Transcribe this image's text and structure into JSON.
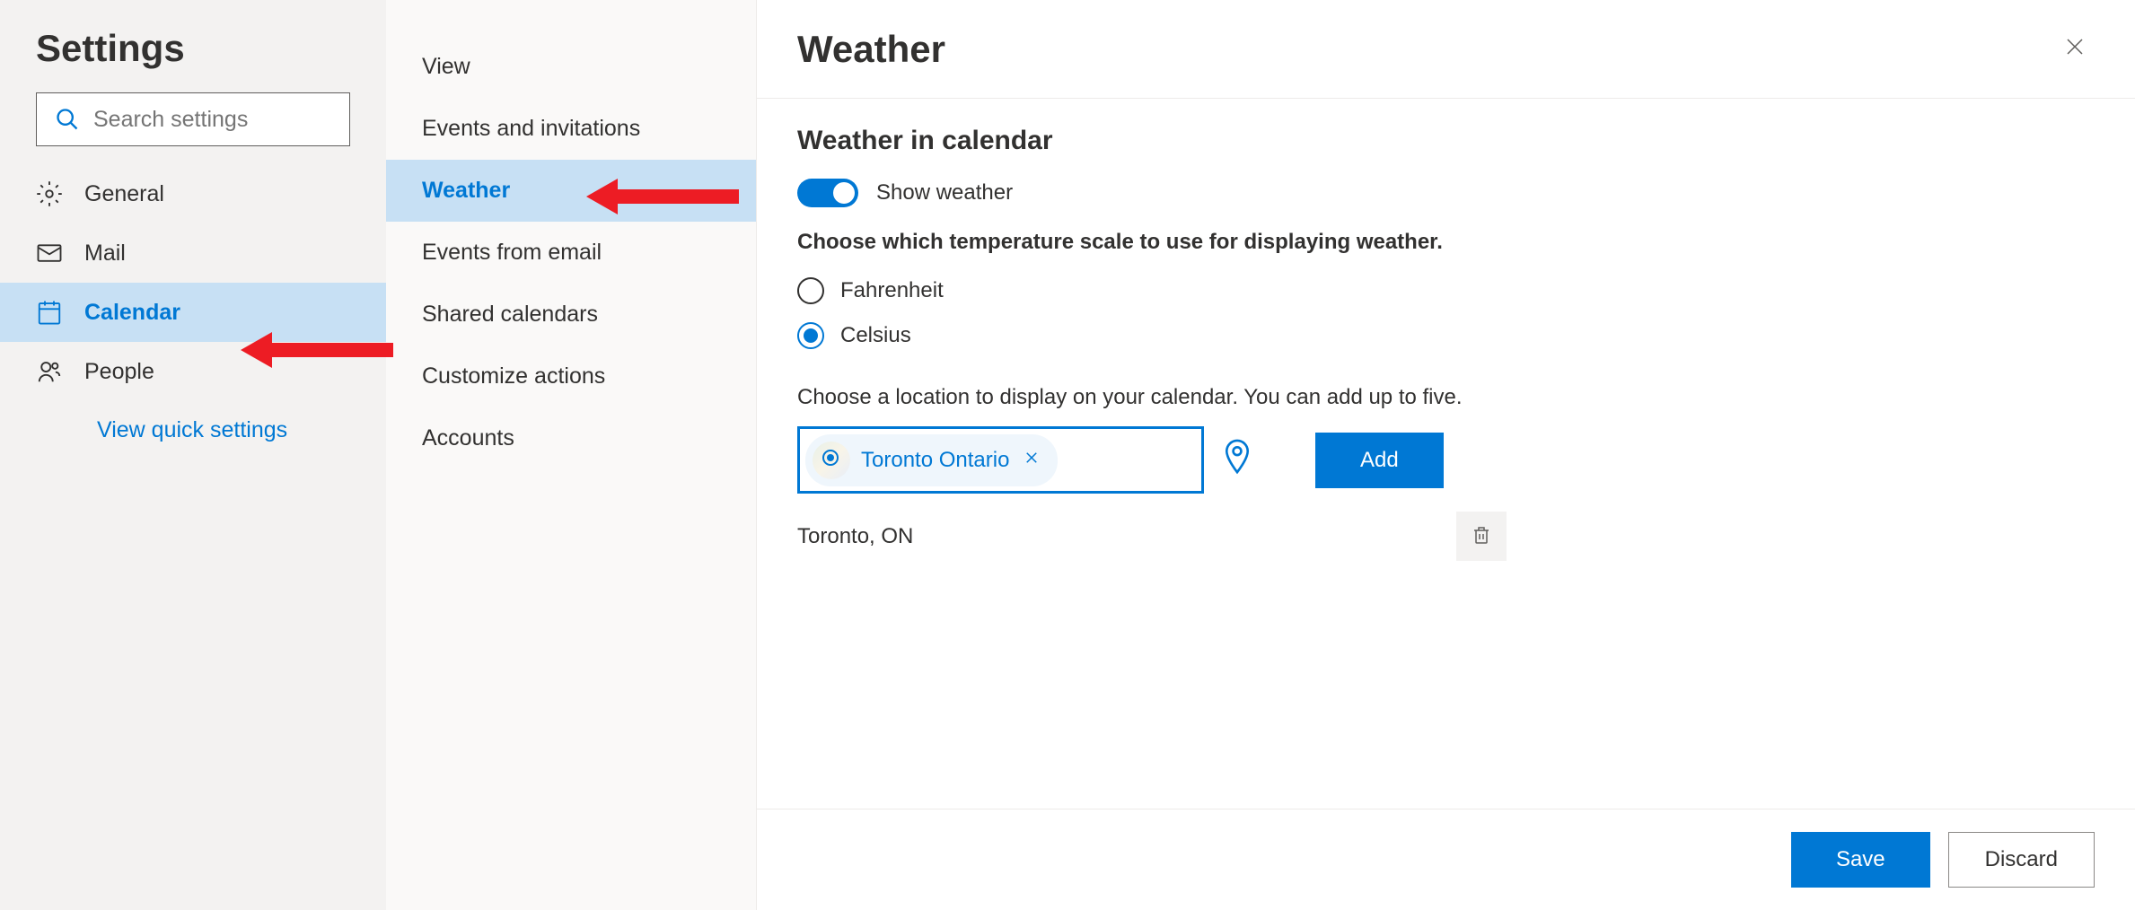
{
  "settings": {
    "title": "Settings",
    "search_placeholder": "Search settings",
    "nav": [
      {
        "label": "General"
      },
      {
        "label": "Mail"
      },
      {
        "label": "Calendar"
      },
      {
        "label": "People"
      }
    ],
    "quick_settings_label": "View quick settings"
  },
  "submenu": {
    "items": [
      {
        "label": "View"
      },
      {
        "label": "Events and invitations"
      },
      {
        "label": "Weather"
      },
      {
        "label": "Events from email"
      },
      {
        "label": "Shared calendars"
      },
      {
        "label": "Customize actions"
      },
      {
        "label": "Accounts"
      }
    ]
  },
  "main": {
    "title": "Weather",
    "section_title": "Weather in calendar",
    "toggle_label": "Show weather",
    "temp_instruction": "Choose which temperature scale to use for displaying weather.",
    "radio_fahrenheit": "Fahrenheit",
    "radio_celsius": "Celsius",
    "location_instruction": "Choose a location to display on your calendar. You can add up to five.",
    "location_chip": "Toronto Ontario",
    "add_label": "Add",
    "location_saved": "Toronto, ON",
    "save_label": "Save",
    "discard_label": "Discard"
  }
}
